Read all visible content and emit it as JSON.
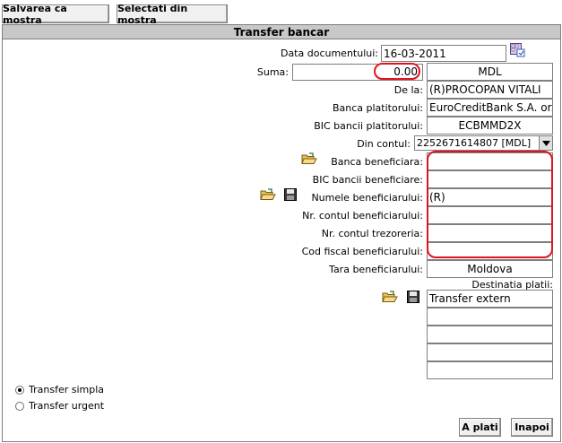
{
  "toolbar": {
    "save_template_label": "Salvarea ca mostra",
    "select_template_label": "Selectati din mostra"
  },
  "panel": {
    "title": "Transfer bancar"
  },
  "form": {
    "document_date": {
      "label": "Data documentului:",
      "value": "16-03-2011"
    },
    "amount": {
      "label": "Suma:",
      "value": "0.00",
      "currency": "MDL"
    },
    "from": {
      "label": "De la:",
      "value": "(R)PROCOPAN VITALI"
    },
    "payer_bank": {
      "label": "Banca platitorului:",
      "value": "EuroCreditBank S.A. or."
    },
    "payer_bic": {
      "label": "BIC bancii platitorului:",
      "value": "ECBMMD2X"
    },
    "from_account": {
      "label": "Din contul:",
      "value": "2252671614807 [MDL]"
    },
    "beneficiary_bank": {
      "label": "Banca beneficiara:",
      "value": ""
    },
    "beneficiary_bic": {
      "label": "BIC bancii beneficiare:",
      "value": ""
    },
    "beneficiary_name": {
      "label": "Numele beneficiarului:",
      "value": "(R)"
    },
    "beneficiary_account": {
      "label": "Nr. contul beneficiarului:",
      "value": ""
    },
    "treasury_account": {
      "label": "Nr. contul trezoreria:",
      "value": ""
    },
    "beneficiary_fiscal_code": {
      "label": "Cod fiscal beneficiarului:",
      "value": ""
    },
    "beneficiary_country": {
      "label": "Tara beneficiarului:",
      "value": "Moldova"
    },
    "payment_purpose": {
      "label": "Destinatia platii:",
      "lines": [
        "Transfer extern",
        "",
        "",
        "",
        ""
      ]
    }
  },
  "transfer_type": {
    "simple_label": "Transfer simpla",
    "urgent_label": "Transfer urgent",
    "selected": "simple"
  },
  "actions": {
    "pay_label": "A plati",
    "back_label": "Inapoi"
  },
  "colors": {
    "title_bar": "#c8c8c8",
    "highlight_ring": "#e0141e",
    "border": "#7f7f7f"
  }
}
